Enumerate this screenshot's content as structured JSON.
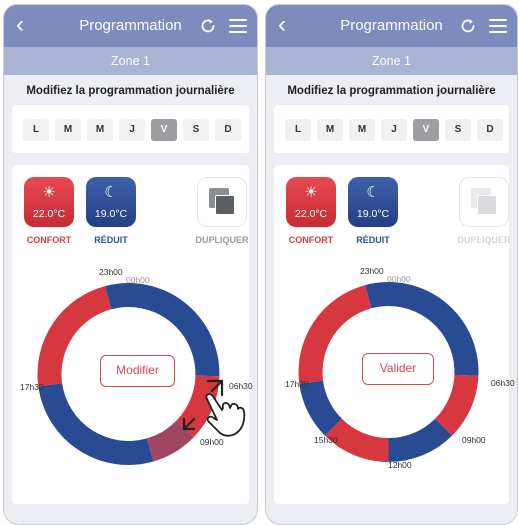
{
  "colors": {
    "header": "#7d8bbd",
    "zone_bar": "#a9b4d4",
    "confort": "#d63b44",
    "reduit": "#2f4f97",
    "ring_red": "#d7373f",
    "ring_blue": "#294b94"
  },
  "left": {
    "header": {
      "back_icon": "chevron-left-icon",
      "title": "Programmation",
      "refresh_icon": "refresh-icon",
      "menu_icon": "hamburger-menu-icon"
    },
    "zone_label": "Zone 1",
    "subtitle": "Modifiez la programmation journalière",
    "days": [
      {
        "label": "L",
        "active": false
      },
      {
        "label": "M",
        "active": false
      },
      {
        "label": "M",
        "active": false
      },
      {
        "label": "J",
        "active": false
      },
      {
        "label": "V",
        "active": true
      },
      {
        "label": "S",
        "active": false
      },
      {
        "label": "D",
        "active": false
      }
    ],
    "modes": {
      "confort": {
        "icon": "sun-icon",
        "temp": "22.0°C",
        "label": "CONFORT"
      },
      "reduit": {
        "icon": "moon-icon",
        "temp": "19.0°C",
        "label": "RÉDUIT"
      },
      "dupliquer": {
        "icon": "duplicate-icon",
        "label": "DUPLIQUER",
        "enabled": true
      }
    },
    "times": {
      "t2300": "23h00",
      "t0000": "00h00",
      "t0630": "06h30",
      "t0900": "09h00",
      "t1730": "17h30"
    },
    "action_button": "Modifier"
  },
  "right": {
    "header": {
      "back_icon": "chevron-left-icon",
      "title": "Programmation",
      "refresh_icon": "refresh-icon",
      "menu_icon": "hamburger-menu-icon"
    },
    "zone_label": "Zone 1",
    "subtitle": "Modifiez la programmation journalière",
    "days": [
      {
        "label": "L",
        "active": false
      },
      {
        "label": "M",
        "active": false
      },
      {
        "label": "M",
        "active": false
      },
      {
        "label": "J",
        "active": false
      },
      {
        "label": "V",
        "active": true
      },
      {
        "label": "S",
        "active": false
      },
      {
        "label": "D",
        "active": false
      }
    ],
    "modes": {
      "confort": {
        "icon": "sun-icon",
        "temp": "22.0°C",
        "label": "CONFORT"
      },
      "reduit": {
        "icon": "moon-icon",
        "temp": "19.0°C",
        "label": "RÉDUIT"
      },
      "dupliquer": {
        "icon": "duplicate-icon",
        "label": "DUPLIQUER",
        "enabled": false
      }
    },
    "times": {
      "t2300": "23h00",
      "t0000": "00h00",
      "t0630": "06h30",
      "t0900": "09h00",
      "t1200": "12h00",
      "t1530": "15h30",
      "t1730": "17h30"
    },
    "action_button": "Valider"
  }
}
